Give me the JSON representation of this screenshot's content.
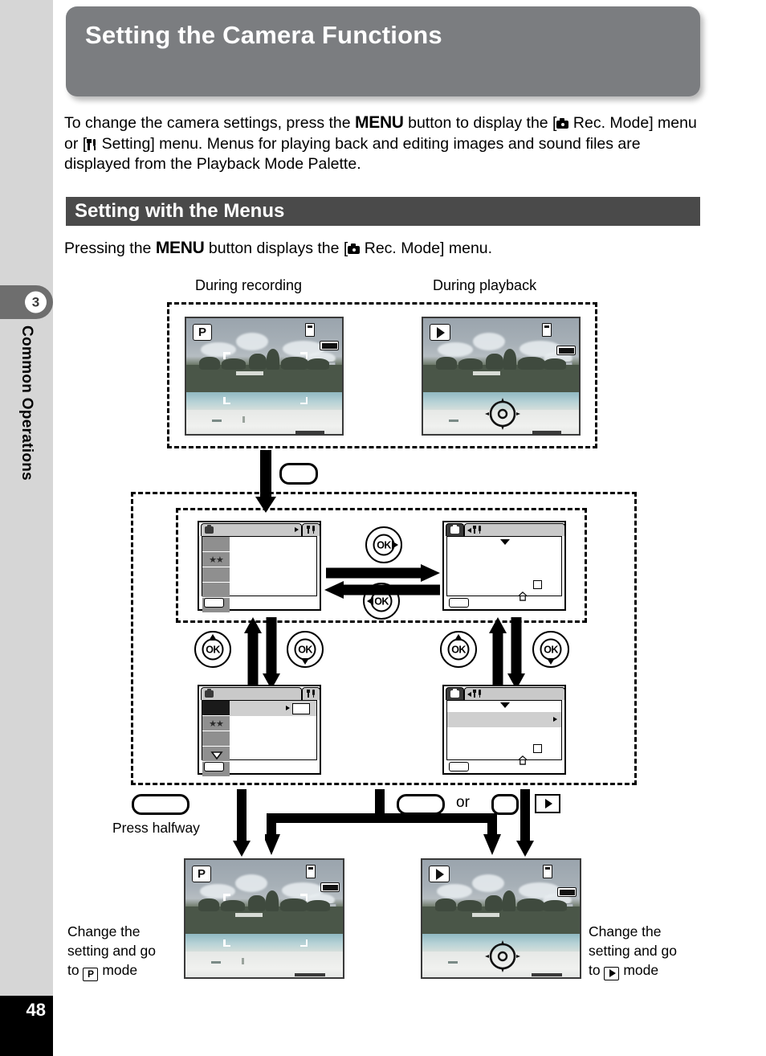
{
  "page": {
    "number": "48",
    "chapter_number": "3",
    "chapter_name": "Common Operations",
    "title": "Setting the Camera Functions"
  },
  "intro": {
    "part1": "To change the camera settings, press the ",
    "menu_key": "MENU",
    "part2": " button to display the [",
    "rec_icon": "camera-icon",
    "part3": " Rec. Mode] menu or [",
    "setting_icon": "wrench-icon",
    "part4": " Setting] menu. Menus for playing back and editing images and sound files are displayed from the Playback Mode Palette."
  },
  "section": {
    "heading": "Setting with the Menus",
    "lead_part1": "Pressing the ",
    "lead_menu_key": "MENU",
    "lead_part2": " button displays the [",
    "lead_part3": " Rec. Mode] menu."
  },
  "diagram": {
    "column_labels": {
      "recording": "During recording",
      "playback": "During playback"
    },
    "lcd_screens": {
      "rec_mode_badge": "P",
      "play_mode_badge": "play-icon",
      "card_icon": "memory-card-icon",
      "battery_icon": "battery-icon",
      "focus_frame": "focus-bracket",
      "pad_overlay": "four-way-pad-icon"
    },
    "menu_screens": {
      "tab_camera": "camera-tab-icon",
      "tab_setting": "wrench-tab-icon",
      "stars": "★★"
    },
    "buttons": {
      "menu_button": "MENU",
      "ok_label": "OK",
      "shutter_label": "shutter-button",
      "play_button": "playback-button",
      "or_text": "or"
    },
    "labels": {
      "press_halfway": "Press halfway",
      "caption_left_line1": "Change the",
      "caption_left_line2": "setting and go",
      "caption_left_line3_pre": "to ",
      "caption_left_badge": "P",
      "caption_left_line3_post": " mode",
      "caption_right_line1": "Change the",
      "caption_right_line2": "setting and go",
      "caption_right_line3_pre": "to ",
      "caption_right_badge": "play-icon",
      "caption_right_line3_post": " mode"
    }
  },
  "colors": {
    "title_bar": "#7b7d80",
    "section_bar": "#4a4a4a",
    "rail": "#d6d6d6",
    "chapter_tab": "#6e6e6e",
    "page_block": "#000000"
  }
}
